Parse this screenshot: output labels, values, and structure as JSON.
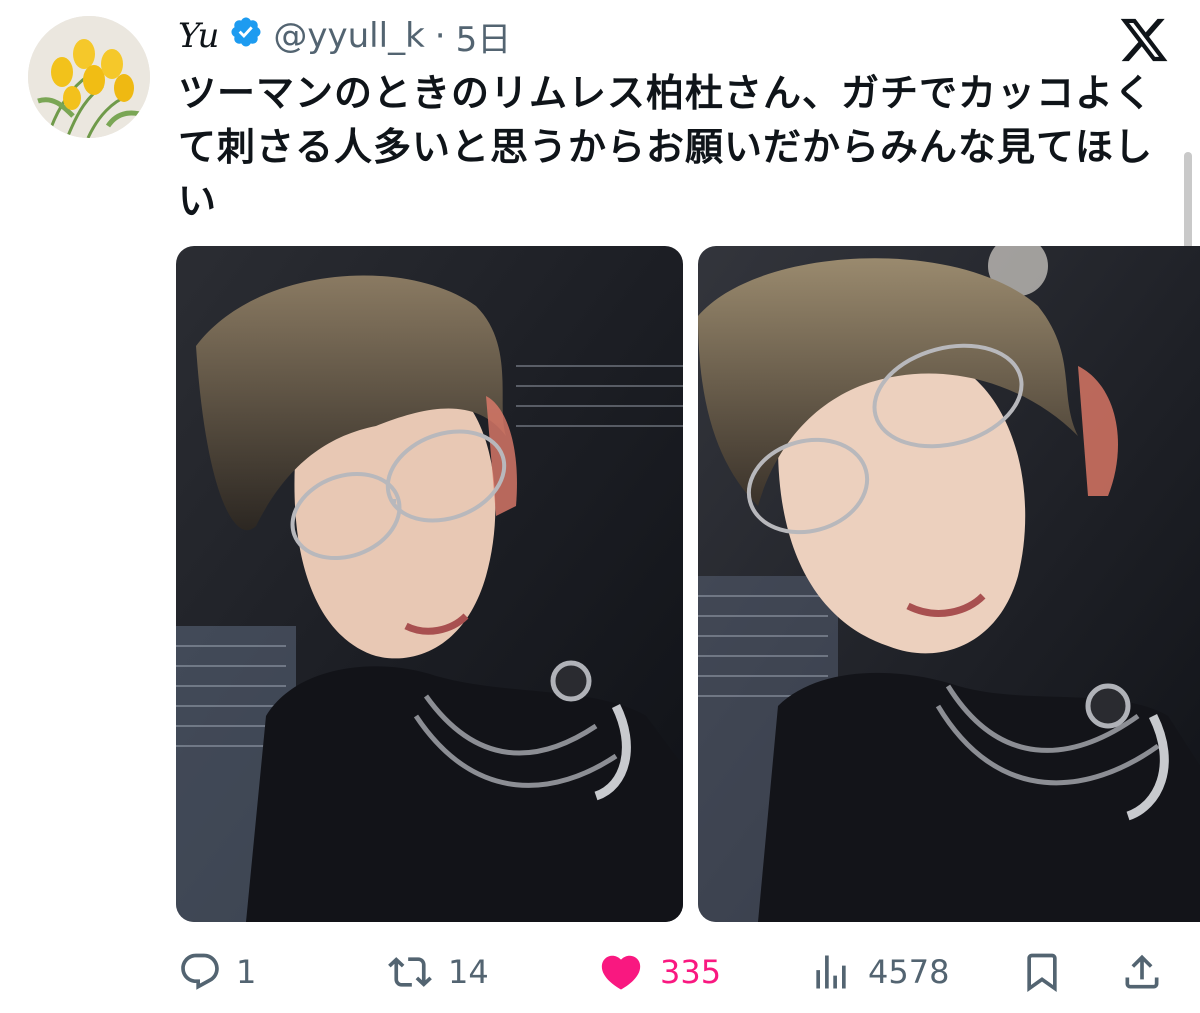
{
  "author": {
    "display_name": "Yu",
    "handle": "@yyull_k",
    "separator": "·",
    "time": "5日"
  },
  "tweet": {
    "text": "ツーマンのときのリムレス柏杜さん、ガチでカッコよくて刺さる人多いと思うからお願いだからみんな見てほしい"
  },
  "media": {
    "count": 2
  },
  "actions": {
    "reply_count": "1",
    "retweet_count": "14",
    "like_count": "335",
    "views_count": "4578"
  },
  "colors": {
    "like": "#f91880",
    "secondary_text": "#536471",
    "verified": "#1d9bf0"
  },
  "icons": [
    "verified-badge-icon",
    "x-logo-icon",
    "reply-icon",
    "retweet-icon",
    "heart-icon",
    "views-icon",
    "bookmark-icon",
    "share-icon"
  ]
}
